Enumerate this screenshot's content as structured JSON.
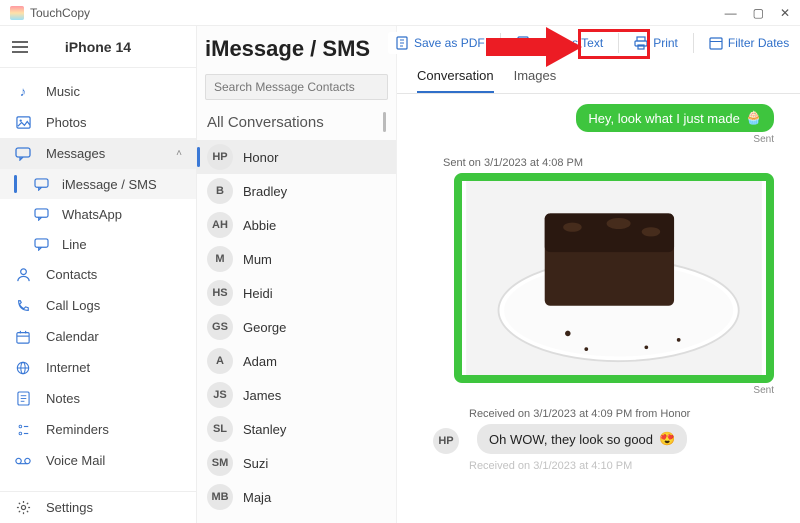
{
  "app": {
    "name": "TouchCopy"
  },
  "window_controls": {
    "min": "—",
    "max": "▢",
    "close": "✕"
  },
  "device": {
    "name": "iPhone 14"
  },
  "sidebar": {
    "items": [
      {
        "label": "Music"
      },
      {
        "label": "Photos"
      },
      {
        "label": "Messages"
      },
      {
        "label": "Contacts"
      },
      {
        "label": "Call Logs"
      },
      {
        "label": "Calendar"
      },
      {
        "label": "Internet"
      },
      {
        "label": "Notes"
      },
      {
        "label": "Reminders"
      },
      {
        "label": "Voice Mail"
      }
    ],
    "sub_messages": [
      {
        "label": "iMessage / SMS"
      },
      {
        "label": "WhatsApp"
      },
      {
        "label": "Line"
      }
    ],
    "settings_label": "Settings"
  },
  "page": {
    "title": "iMessage / SMS",
    "toolbar": {
      "save_pdf": "Save as PDF",
      "save_text": "Save as Text",
      "print": "Print",
      "filter_dates": "Filter Dates"
    },
    "search_placeholder": "Search Message Contacts",
    "all_conversations": "All Conversations",
    "tabs": {
      "conversation": "Conversation",
      "images": "Images"
    }
  },
  "contacts": [
    {
      "initials": "HP",
      "name": "Honor"
    },
    {
      "initials": "B",
      "name": "Bradley"
    },
    {
      "initials": "AH",
      "name": "Abbie"
    },
    {
      "initials": "M",
      "name": "Mum"
    },
    {
      "initials": "HS",
      "name": "Heidi"
    },
    {
      "initials": "GS",
      "name": "George"
    },
    {
      "initials": "A",
      "name": "Adam"
    },
    {
      "initials": "JS",
      "name": "James"
    },
    {
      "initials": "SL",
      "name": "Stanley"
    },
    {
      "initials": "SM",
      "name": "Suzi"
    },
    {
      "initials": "MB",
      "name": "Maja"
    }
  ],
  "thread": {
    "out1": {
      "text": "Hey, look what I just made",
      "emoji": "🧁",
      "status": "Sent"
    },
    "out2_ts": "Sent on 3/1/2023 at 4:08 PM",
    "out2_status": "Sent",
    "in1_ts": "Received on 3/1/2023 at 4:09 PM from Honor",
    "in1_avatar": "HP",
    "in1_text": "Oh WOW, they look so good",
    "in1_emoji": "😍",
    "in2_ts": "Received on 3/1/2023 at 4:10 PM"
  }
}
